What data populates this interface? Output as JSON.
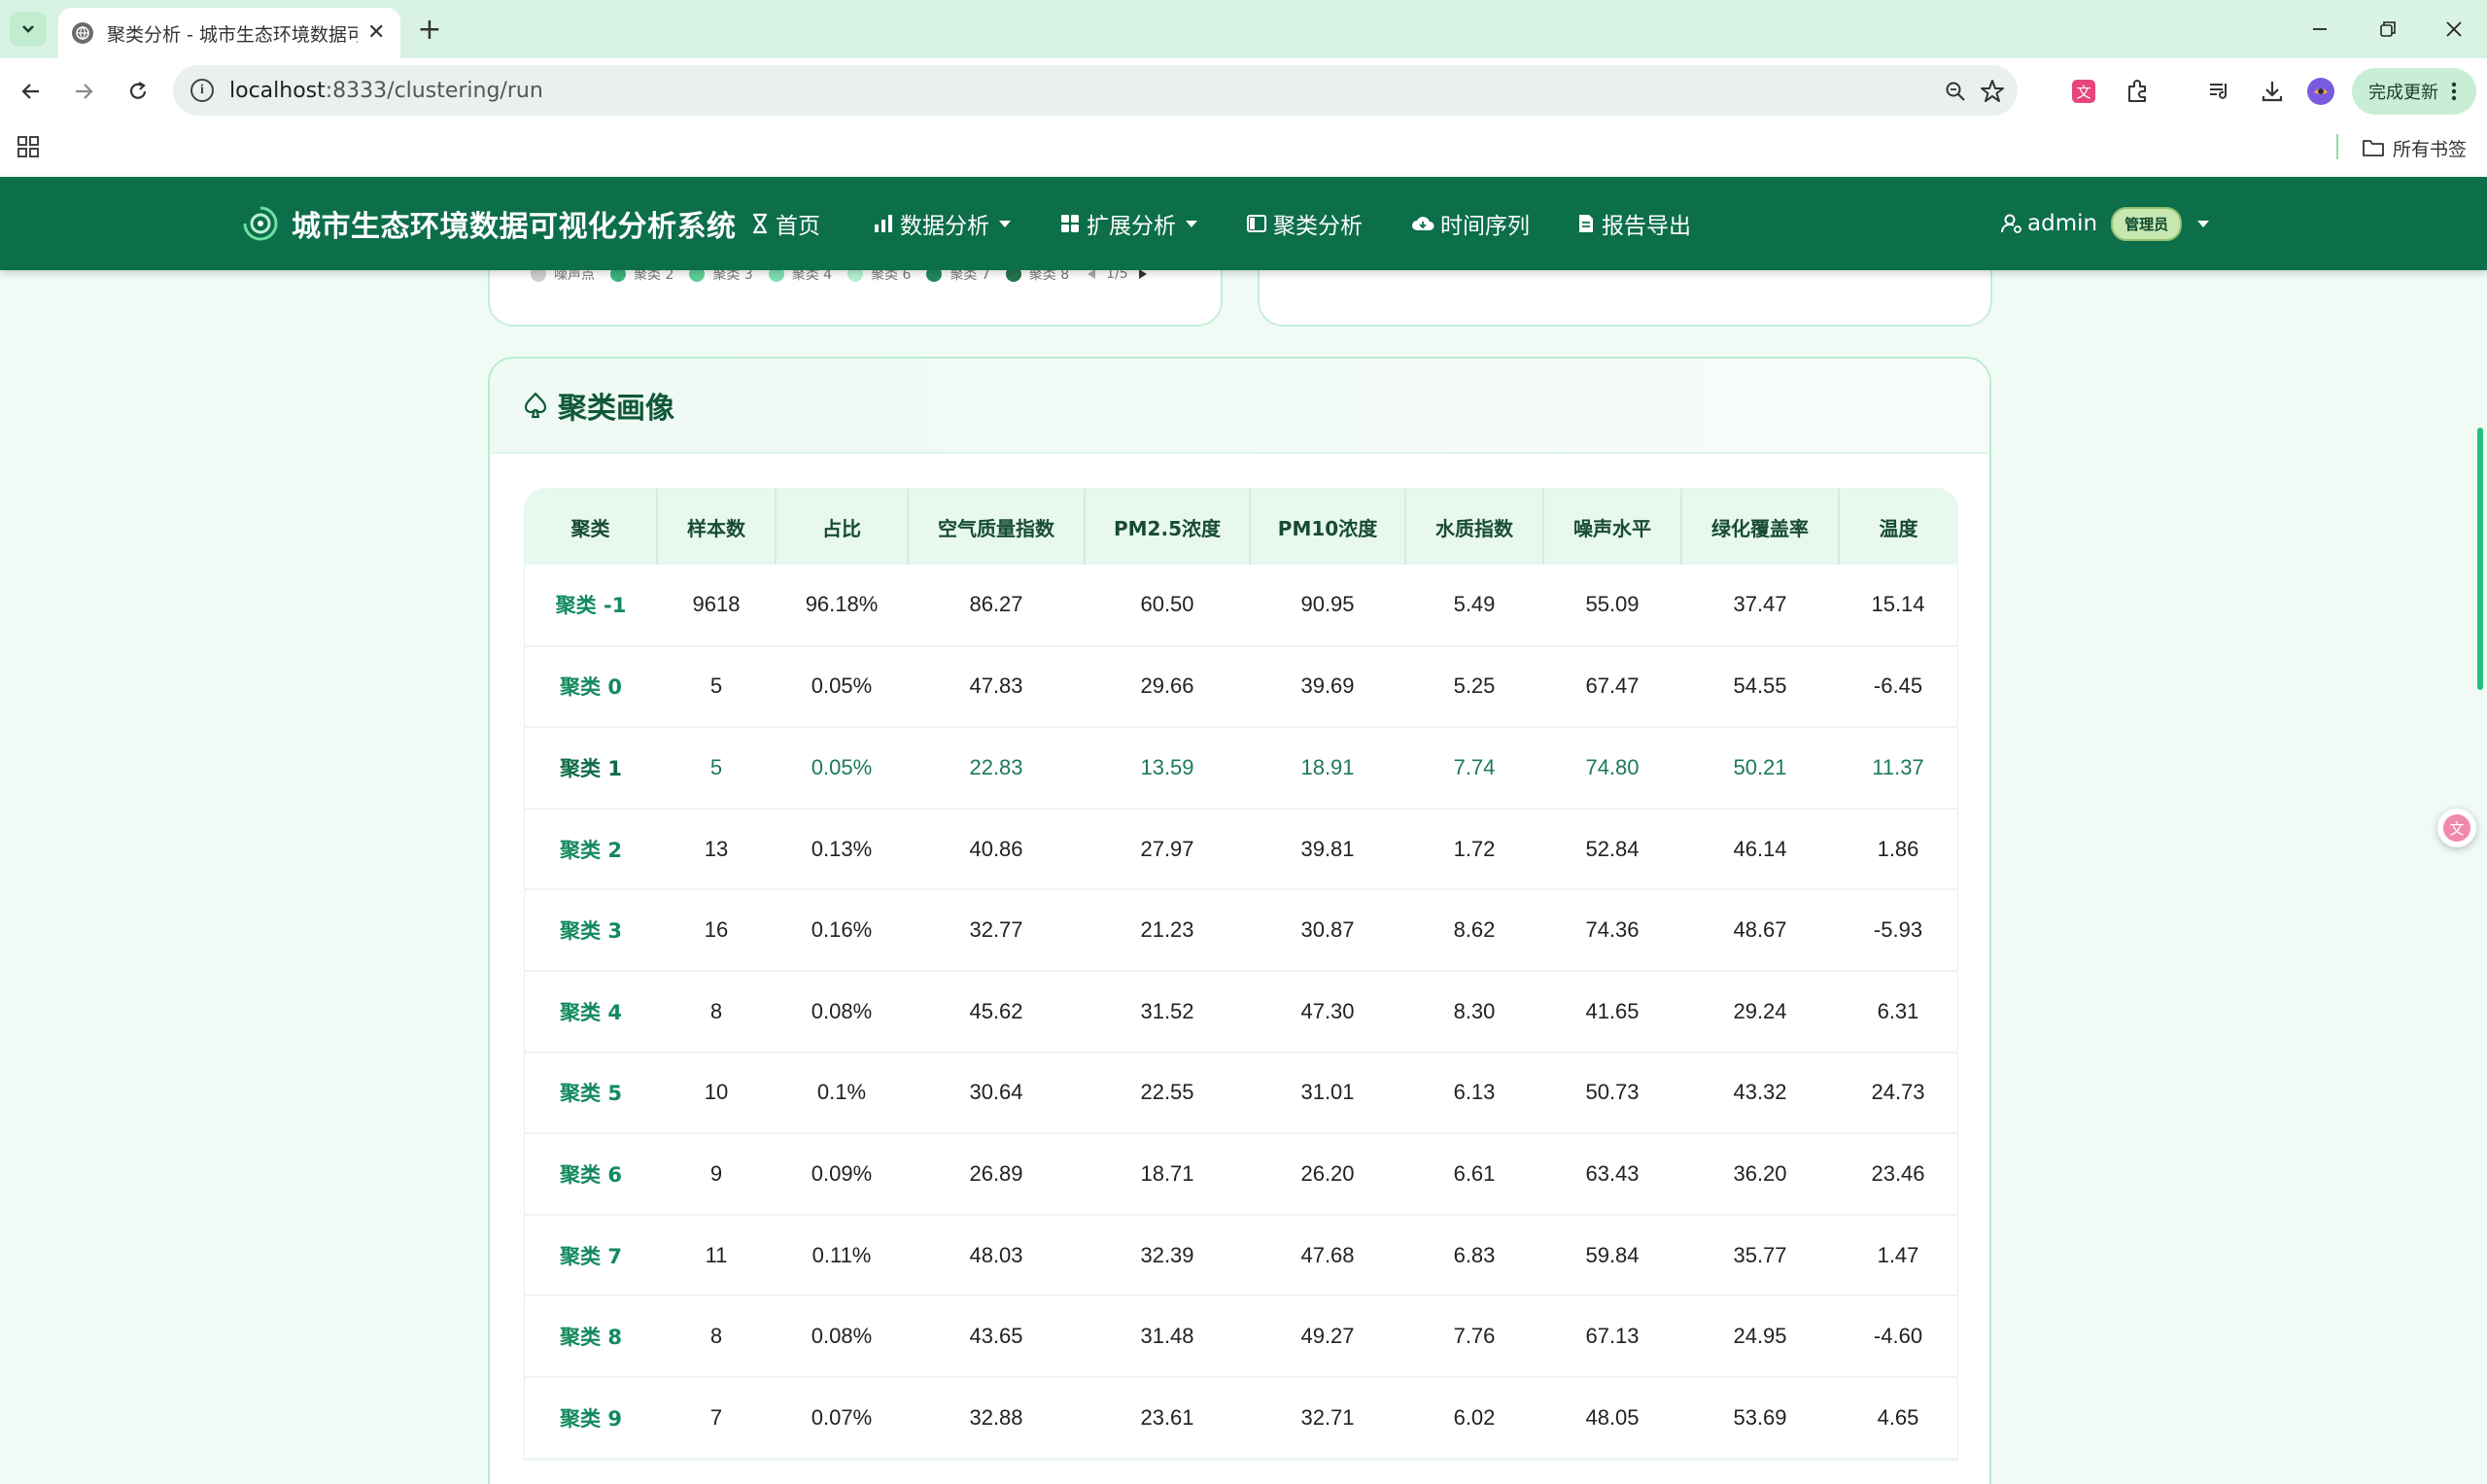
{
  "browser": {
    "tab_title": "聚类分析 - 城市生态环境数据可视化分析系统",
    "url_host": "localhost",
    "url_rest": ":8333/clustering/run",
    "update_label": "完成更新",
    "bookmarks_all": "所有书签"
  },
  "nav": {
    "brand": "城市生态环境数据可视化分析系统",
    "items": [
      {
        "label": "首页",
        "icon": "hourglass-icon"
      },
      {
        "label": "数据分析",
        "icon": "bar-chart-icon"
      },
      {
        "label": "扩展分析",
        "icon": "grid-icon"
      },
      {
        "label": "聚类分析",
        "icon": "window-icon"
      },
      {
        "label": "时间序列",
        "icon": "cloud-icon"
      },
      {
        "label": "报告导出",
        "icon": "document-icon"
      }
    ],
    "user": "admin",
    "role_badge": "管理员"
  },
  "legend": {
    "items": [
      "噪声点",
      "聚类 2",
      "聚类 3",
      "聚类 4",
      "聚类 6",
      "聚类 7",
      "聚类 8"
    ],
    "colors": [
      "#d0d0d0",
      "#3cb27e",
      "#5ccf97",
      "#7ee0b1",
      "#b6efd2",
      "#1e8a5c",
      "#27734f"
    ],
    "page": "1/5"
  },
  "portrait": {
    "title": "聚类画像",
    "columns": [
      "聚类",
      "样本数",
      "占比",
      "空气质量指数",
      "PM2.5浓度",
      "PM10浓度",
      "水质指数",
      "噪声水平",
      "绿化覆盖率",
      "温度"
    ],
    "rows": [
      [
        "聚类 -1",
        "9618",
        "96.18%",
        "86.27",
        "60.50",
        "90.95",
        "5.49",
        "55.09",
        "37.47",
        "15.14"
      ],
      [
        "聚类 0",
        "5",
        "0.05%",
        "47.83",
        "29.66",
        "39.69",
        "5.25",
        "67.47",
        "54.55",
        "-6.45"
      ],
      [
        "聚类 1",
        "5",
        "0.05%",
        "22.83",
        "13.59",
        "18.91",
        "7.74",
        "74.80",
        "50.21",
        "11.37"
      ],
      [
        "聚类 2",
        "13",
        "0.13%",
        "40.86",
        "27.97",
        "39.81",
        "1.72",
        "52.84",
        "46.14",
        "1.86"
      ],
      [
        "聚类 3",
        "16",
        "0.16%",
        "32.77",
        "21.23",
        "30.87",
        "8.62",
        "74.36",
        "48.67",
        "-5.93"
      ],
      [
        "聚类 4",
        "8",
        "0.08%",
        "45.62",
        "31.52",
        "47.30",
        "8.30",
        "41.65",
        "29.24",
        "6.31"
      ],
      [
        "聚类 5",
        "10",
        "0.1%",
        "30.64",
        "22.55",
        "31.01",
        "6.13",
        "50.73",
        "43.32",
        "24.73"
      ],
      [
        "聚类 6",
        "9",
        "0.09%",
        "26.89",
        "18.71",
        "26.20",
        "6.61",
        "63.43",
        "36.20",
        "23.46"
      ],
      [
        "聚类 7",
        "11",
        "0.11%",
        "48.03",
        "32.39",
        "47.68",
        "6.83",
        "59.84",
        "35.77",
        "1.47"
      ],
      [
        "聚类 8",
        "8",
        "0.08%",
        "43.65",
        "31.48",
        "49.27",
        "7.76",
        "67.13",
        "24.95",
        "-4.60"
      ],
      [
        "聚类 9",
        "7",
        "0.07%",
        "32.88",
        "23.61",
        "32.71",
        "6.02",
        "48.05",
        "53.69",
        "4.65"
      ]
    ],
    "highlight_row": 2
  },
  "colors": {
    "nav_bg": "#0d6e4a",
    "accent": "#138a5e",
    "page_bg": "#f1fbf5"
  }
}
